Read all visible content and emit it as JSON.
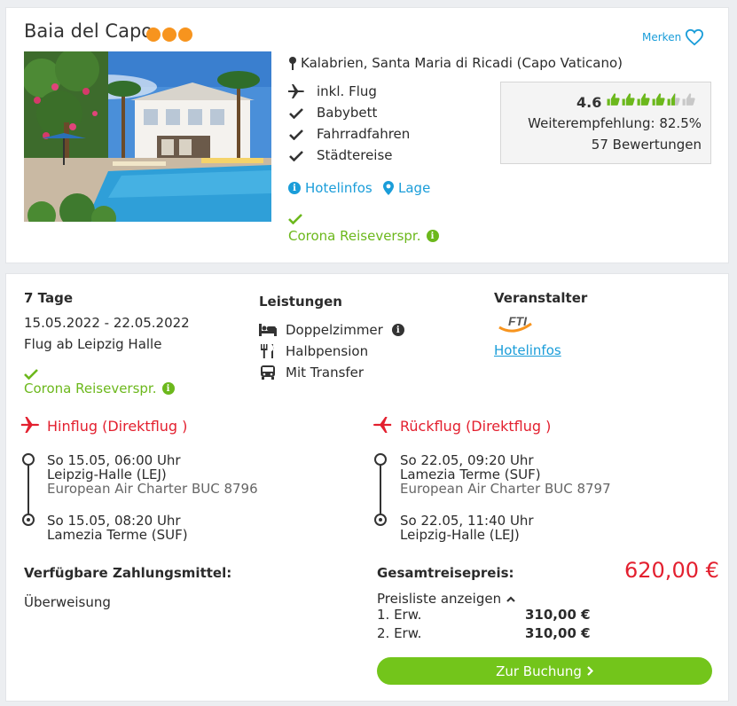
{
  "hotel": {
    "name": "Baia del Capo",
    "category_dots": 3,
    "merken_label": "Merken",
    "location": "Kalabrien, Santa Maria di Ricadi (Capo Vaticano)",
    "features": [
      {
        "icon": "plane-icon",
        "label": "inkl. Flug"
      },
      {
        "icon": "check-icon",
        "label": "Babybett"
      },
      {
        "icon": "check-icon",
        "label": "Fahrradfahren"
      },
      {
        "icon": "check-icon",
        "label": "Städtereise"
      }
    ],
    "links": {
      "hotelinfos": "Hotelinfos",
      "lage": "Lage"
    },
    "corona": "Corona Reiseverspr.",
    "rating": {
      "score": "4.6",
      "thumbs_value": 4.6,
      "recommendation": "Weiterempfehlung: 82.5%",
      "reviews": "57 Bewertungen"
    }
  },
  "offer": {
    "duration": "7 Tage",
    "dates": "15.05.2022 - 22.05.2022",
    "departure": "Flug ab Leipzig Halle",
    "corona": "Corona Reiseverspr.",
    "services_title": "Leistungen",
    "services": [
      {
        "icon": "bed-icon",
        "label": "Doppelzimmer"
      },
      {
        "icon": "cutlery-icon",
        "label": "Halbpension"
      },
      {
        "icon": "bus-icon",
        "label": "Mit Transfer"
      }
    ],
    "operator_title": "Veranstalter",
    "operator_logo": "FTI",
    "operator_link": "Hotelinfos",
    "outbound": {
      "title": "Hinflug (Direktflug )",
      "dep_time": "So 15.05, 06:00 Uhr",
      "dep_airport": "Leipzig-Halle (LEJ)",
      "carrier": "European Air Charter BUC 8796",
      "arr_time": "So 15.05, 08:20 Uhr",
      "arr_airport": "Lamezia Terme (SUF)"
    },
    "return": {
      "title": "Rückflug (Direktflug )",
      "dep_time": "So 22.05, 09:20 Uhr",
      "dep_airport": "Lamezia Terme (SUF)",
      "carrier": "European Air Charter BUC 8797",
      "arr_time": "So 22.05, 11:40 Uhr",
      "arr_airport": "Leipzig-Halle (LEJ)"
    },
    "payment_title": "Verfügbare Zahlungsmittel:",
    "payment_method": "Überweisung",
    "total_label": "Gesamtreisepreis:",
    "total_price": "620,00 €",
    "pricelist_label": "Preisliste anzeigen",
    "price_rows": [
      {
        "label": "1. Erw.",
        "value": "310,00 €"
      },
      {
        "label": "2. Erw.",
        "value": "310,00 €"
      }
    ],
    "book_label": "Zur Buchung"
  },
  "colors": {
    "accent_blue": "#1a9dd9",
    "green": "#6cb81c",
    "red": "#e3202f",
    "orange": "#f7941e",
    "button_green": "#73c51b"
  }
}
